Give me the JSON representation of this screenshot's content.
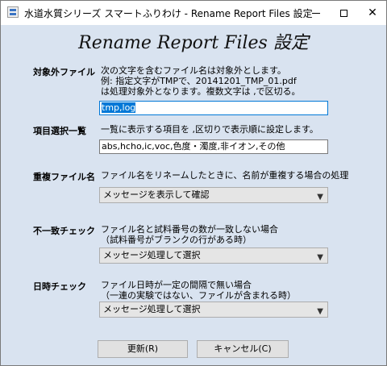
{
  "window": {
    "title": "水道水質シリーズ スマートふりわけ - Rename Report Files 設定"
  },
  "heading": "Rename Report Files 設定",
  "exclude": {
    "label": "対象外ファイル",
    "desc_lines": [
      "次の文字を含むファイル名は対象外とします。",
      "例: 指定文字がTMPで、20141201_TMP_01.pdf",
      "は処理対象外となります。複数文字は ,で区切る。"
    ],
    "value_selected": "tmp,log"
  },
  "columns": {
    "label": "項目選択一覧",
    "desc": "一覧に表示する項目を ,区切りで表示順に設定します。",
    "value": "abs,hcho,ic,voc,色度・濁度,非イオン,その他"
  },
  "duplicate": {
    "label": "重複ファイル名",
    "desc": "ファイル名をリネームしたときに、名前が重複する場合の処理",
    "selected": "メッセージを表示して確認"
  },
  "mismatch": {
    "label": "不一致チェック",
    "desc_lines": [
      "ファイル名と試料番号の数が一致しない場合",
      "（試料番号がブランクの行がある時）"
    ],
    "selected": "メッセージ処理して選択"
  },
  "datetime": {
    "label": "日時チェック",
    "desc_lines": [
      "ファイル日時が一定の間隔で無い場合",
      "（一連の実験ではない、ファイルが含まれる時）"
    ],
    "selected": "メッセージ処理して選択"
  },
  "buttons": {
    "update": "更新(R)",
    "cancel": "キャンセル(C)"
  },
  "colors": {
    "background": "#d9e3f0",
    "focus_accent": "#0078d7"
  }
}
